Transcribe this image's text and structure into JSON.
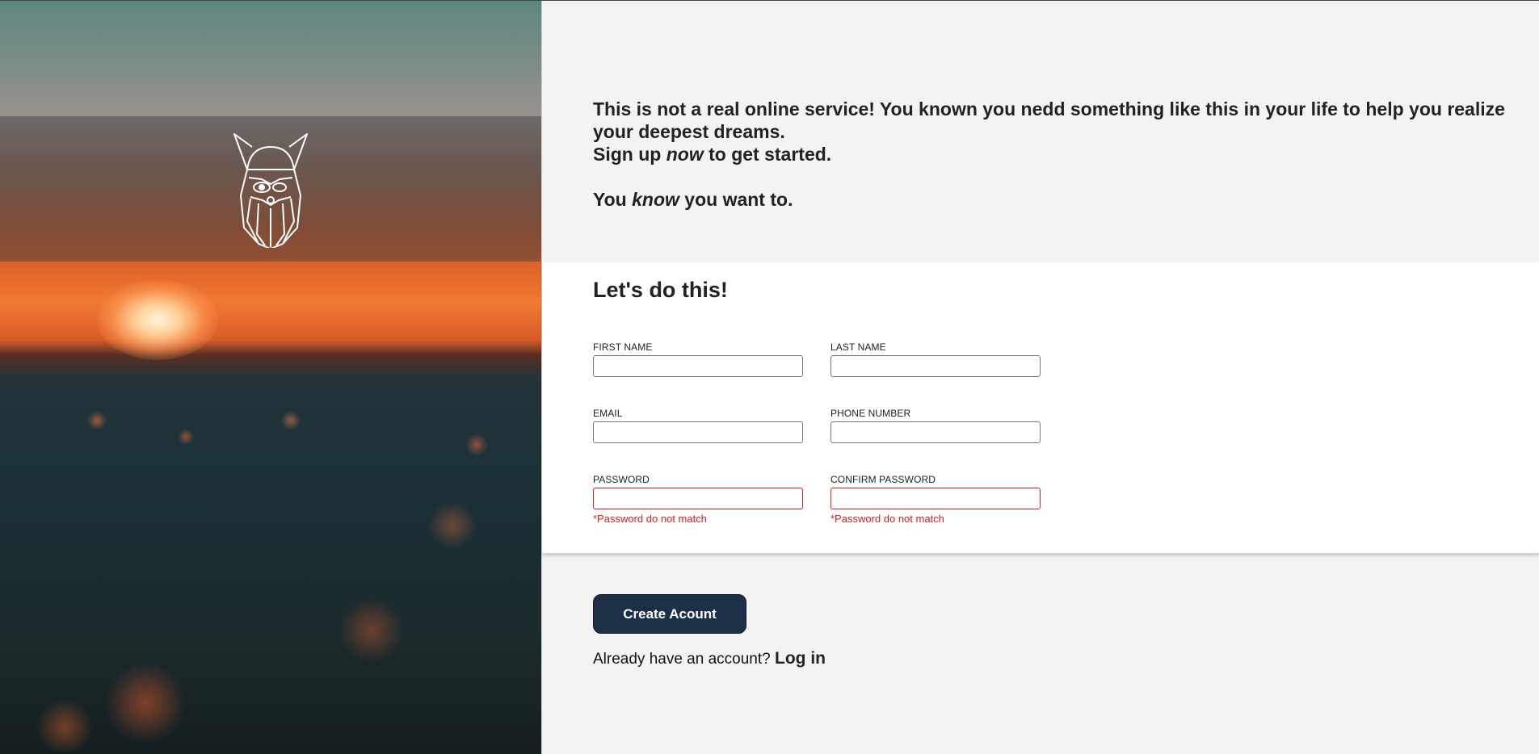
{
  "hero": {
    "logo_icon": "viking-head-icon"
  },
  "intro": {
    "line1": "This is not a real online service! You known you nedd something like this in your life to help you realize your deepest dreams.",
    "line2_before": "Sign up ",
    "line2_emph": "now",
    "line2_after": " to get started.",
    "line3_before": "You ",
    "line3_emph": "know",
    "line3_after": " you want to."
  },
  "form": {
    "heading": "Let's do this!",
    "fields": {
      "first_name": {
        "label": "FIRST NAME",
        "value": ""
      },
      "last_name": {
        "label": "LAST NAME",
        "value": ""
      },
      "email": {
        "label": "EMAIL",
        "value": ""
      },
      "phone": {
        "label": "PHONE NUMBER",
        "value": ""
      },
      "password": {
        "label": "PASSWORD",
        "value": "",
        "error": "*Password do not match"
      },
      "confirm_password": {
        "label": "CONFIRM PASSWORD",
        "value": "",
        "error": "*Password do not match"
      }
    },
    "error_color": "#d21f1f"
  },
  "actions": {
    "create_label": "Create Acount",
    "login_prompt": "Already have an account?",
    "login_link": "Log in",
    "button_color": "#1c2f47"
  }
}
